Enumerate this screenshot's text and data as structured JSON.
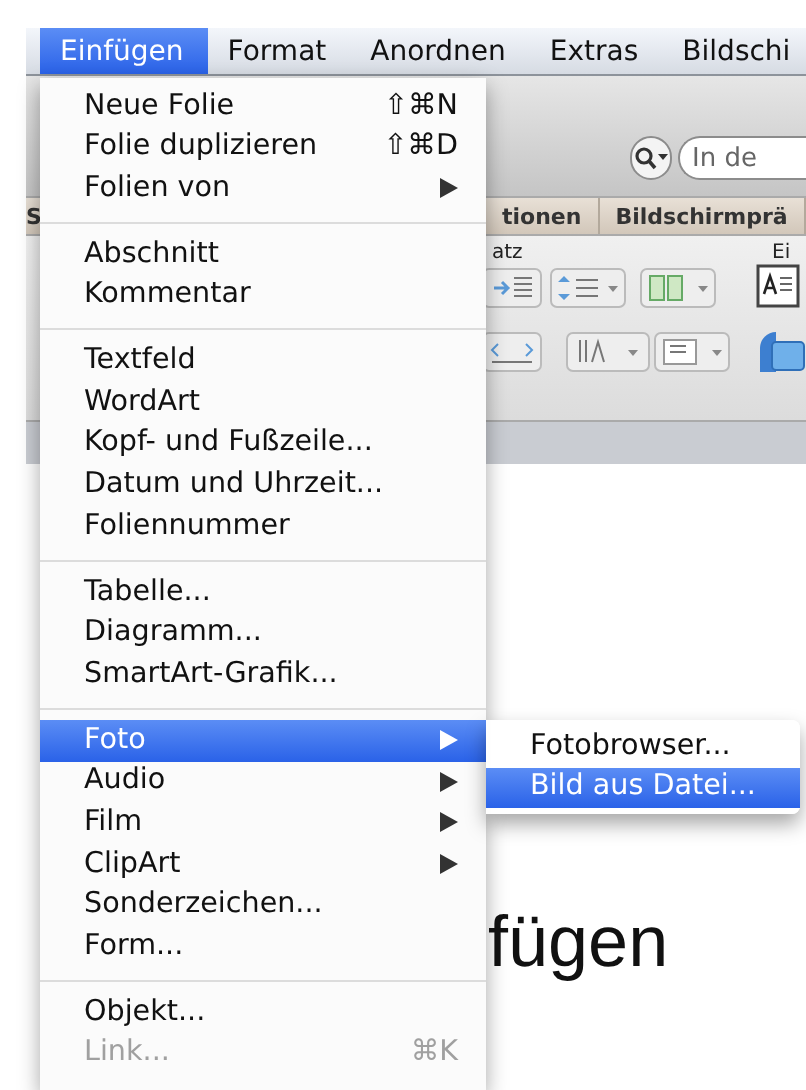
{
  "menubar": [
    {
      "label": "Einfügen",
      "selected": true
    },
    {
      "label": "Format",
      "selected": false
    },
    {
      "label": "Anordnen",
      "selected": false
    },
    {
      "label": "Extras",
      "selected": false
    },
    {
      "label": "Bildschi",
      "selected": false
    }
  ],
  "background": {
    "search": {
      "placeholder": "In de"
    },
    "ribbon_tabs": [
      "S",
      "tionen",
      "Bildschirmprä"
    ],
    "group_labels": [
      "atz",
      "Ei"
    ],
    "slide_title": "fügen"
  },
  "menu": [
    [
      {
        "label": "Neue Folie",
        "shortcut": "⇧⌘N",
        "submenu": false,
        "disabled": false,
        "selected": false
      },
      {
        "label": "Folie duplizieren",
        "shortcut": "⇧⌘D",
        "submenu": false,
        "disabled": false,
        "selected": false
      },
      {
        "label": "Folien von",
        "submenu": true,
        "disabled": false,
        "selected": false
      }
    ],
    [
      {
        "label": "Abschnitt",
        "submenu": false,
        "disabled": false,
        "selected": false
      },
      {
        "label": "Kommentar",
        "submenu": false,
        "disabled": false,
        "selected": false
      }
    ],
    [
      {
        "label": "Textfeld",
        "submenu": false,
        "disabled": false,
        "selected": false
      },
      {
        "label": "WordArt",
        "submenu": false,
        "disabled": false,
        "selected": false
      },
      {
        "label": "Kopf- und Fußzeile...",
        "submenu": false,
        "disabled": false,
        "selected": false
      },
      {
        "label": "Datum und Uhrzeit...",
        "submenu": false,
        "disabled": false,
        "selected": false
      },
      {
        "label": "Foliennummer",
        "submenu": false,
        "disabled": false,
        "selected": false
      }
    ],
    [
      {
        "label": "Tabelle...",
        "submenu": false,
        "disabled": false,
        "selected": false
      },
      {
        "label": "Diagramm...",
        "submenu": false,
        "disabled": false,
        "selected": false
      },
      {
        "label": "SmartArt-Grafik...",
        "submenu": false,
        "disabled": false,
        "selected": false
      }
    ],
    [
      {
        "label": "Foto",
        "submenu": true,
        "disabled": false,
        "selected": true
      },
      {
        "label": "Audio",
        "submenu": true,
        "disabled": false,
        "selected": false
      },
      {
        "label": "Film",
        "submenu": true,
        "disabled": false,
        "selected": false
      },
      {
        "label": "ClipArt",
        "submenu": true,
        "disabled": false,
        "selected": false
      },
      {
        "label": "Sonderzeichen...",
        "submenu": false,
        "disabled": false,
        "selected": false
      },
      {
        "label": "Form...",
        "submenu": false,
        "disabled": false,
        "selected": false
      }
    ],
    [
      {
        "label": "Objekt...",
        "submenu": false,
        "disabled": false,
        "selected": false
      },
      {
        "label": "Link...",
        "shortcut": "⌘K",
        "submenu": false,
        "disabled": true,
        "selected": false
      }
    ]
  ],
  "submenu": [
    {
      "label": "Fotobrowser...",
      "selected": false
    },
    {
      "label": "Bild aus Datei...",
      "selected": true
    }
  ]
}
